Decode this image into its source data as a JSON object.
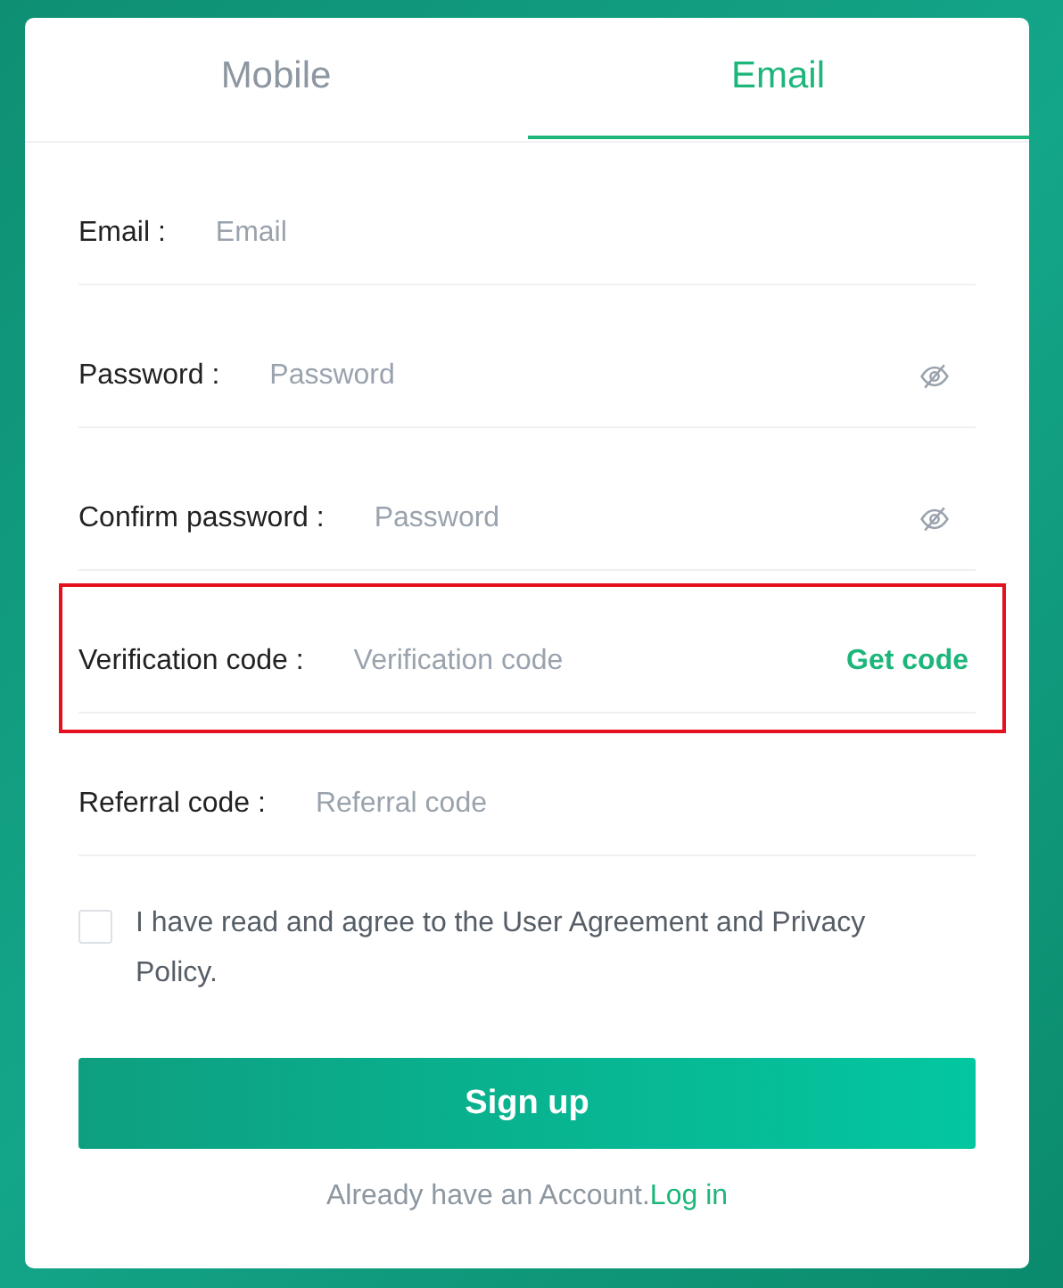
{
  "tabs": [
    {
      "label": "Mobile",
      "selected": false
    },
    {
      "label": "Email",
      "selected": true
    }
  ],
  "fields": [
    {
      "label": "Email :",
      "placeholder": "Email",
      "kind": "text",
      "highlighted": false
    },
    {
      "label": "Password :",
      "placeholder": "Password",
      "kind": "password",
      "highlighted": false
    },
    {
      "label": "Confirm password :",
      "placeholder": "Password",
      "kind": "password",
      "highlighted": false
    },
    {
      "label": "Verification code :",
      "placeholder": "Verification code",
      "kind": "code",
      "action": "Get code",
      "highlighted": true
    },
    {
      "label": "Referral code :",
      "placeholder": "Referral code",
      "kind": "text",
      "highlighted": false
    }
  ],
  "agreement": {
    "text": "I have read and agree to the User Agreement and Privacy Policy.",
    "checked": false
  },
  "submit_button": "Sign up",
  "footer": {
    "text": "Already have an Account.",
    "link": "Log in"
  }
}
